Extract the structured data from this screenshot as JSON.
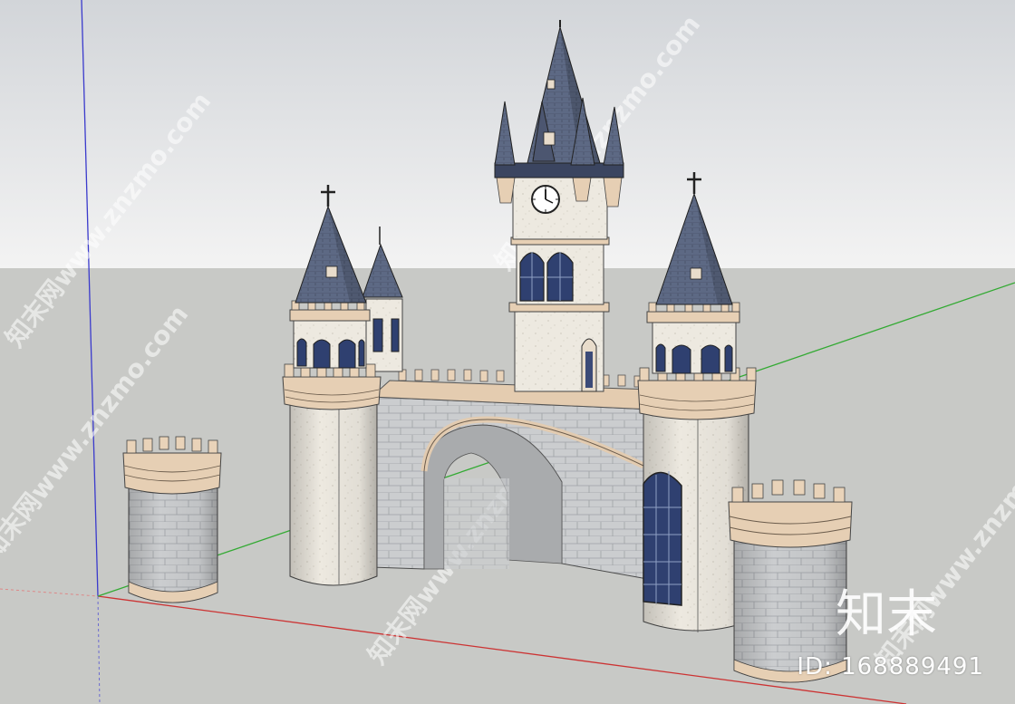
{
  "watermark": {
    "site_text": "知末网www.znzmo.com",
    "brand_text": "知末",
    "id_text": "ID: 168889491"
  },
  "model": {
    "subject": "castle-gate-with-clock-tower"
  },
  "colors": {
    "sky_top": "#d5d8dc",
    "sky_bottom": "#f1f2f2",
    "ground": "#c8c9c6",
    "stone_light": "#eeeae2",
    "brick_gray": "#c9cbcd",
    "trim_beige": "#e6cfb4",
    "roof_slate": "#56627b",
    "window_navy": "#2f4070",
    "axis_red": "#cc3333",
    "axis_green": "#33aa33",
    "axis_blue": "#3333cc"
  }
}
